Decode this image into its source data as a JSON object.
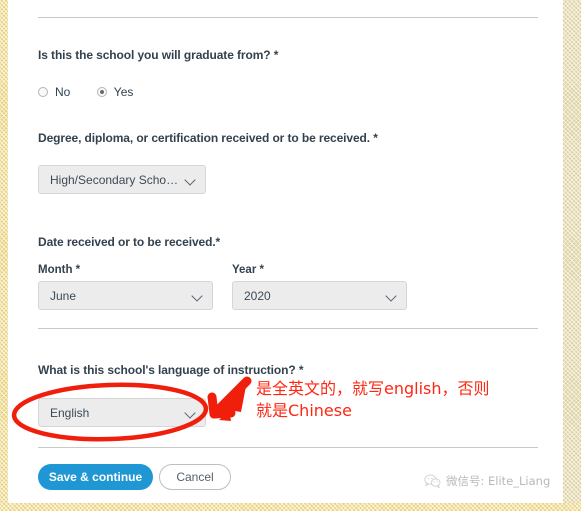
{
  "form": {
    "graduate_question": {
      "label": "Is this the school you will graduate from? *",
      "options": [
        {
          "label": "No",
          "selected": false
        },
        {
          "label": "Yes",
          "selected": true
        }
      ]
    },
    "degree_question": {
      "label": "Degree, diploma, or certification received or to be received. *",
      "value": "High/Secondary Scho…"
    },
    "date_question": {
      "label": "Date received or to be received.*",
      "month": {
        "label": "Month *",
        "value": "June"
      },
      "year": {
        "label": "Year *",
        "value": "2020"
      }
    },
    "language_question": {
      "label": "What is this school's language of instruction? *",
      "value": "English"
    }
  },
  "actions": {
    "save_label": "Save & continue",
    "cancel_label": "Cancel"
  },
  "annotation": {
    "line1": "是全英文的，就写english，否则",
    "line2": "就是Chinese",
    "color": "#fe2712"
  },
  "watermark": {
    "text": "微信号: Elite_Liang",
    "icon": "wechat-icon"
  },
  "colors": {
    "primary_button": "#1f97d4",
    "text": "#33424e",
    "field_background": "#ececed",
    "frame": "#e9d27e"
  }
}
